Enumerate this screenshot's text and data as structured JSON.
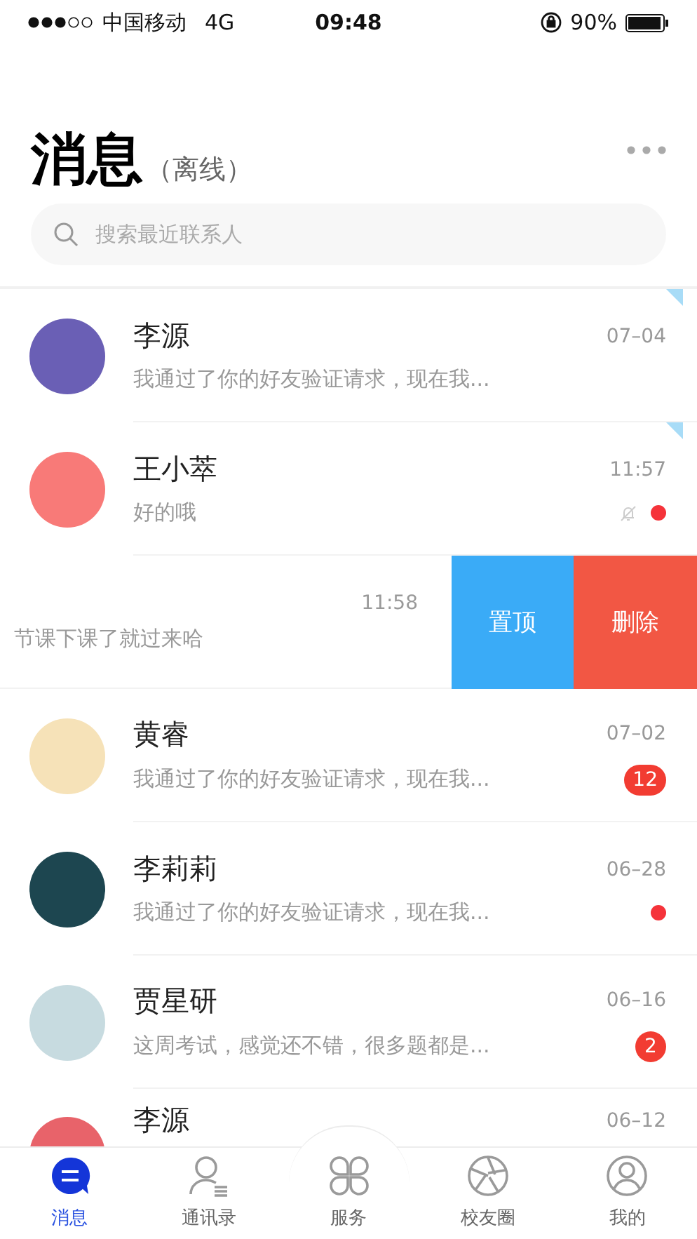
{
  "status_bar": {
    "carrier": "中国移动",
    "network": "4G",
    "time": "09:48",
    "battery": "90%"
  },
  "header": {
    "title": "消息",
    "subtitle": "（离线）"
  },
  "search": {
    "placeholder": "搜索最近联系人"
  },
  "conversations": [
    {
      "kind": "normal",
      "name": "李源",
      "preview": "我通过了你的好友验证请求，现在我...",
      "time": "07–04",
      "color": "#6a5fb5",
      "pinned": true,
      "muted": false,
      "dot": false
    },
    {
      "kind": "normal",
      "name": "王小萃",
      "preview": "好的哦",
      "time": "11:57",
      "color": "#f87a78",
      "pinned": true,
      "muted": true,
      "dot": true
    },
    {
      "kind": "swiped",
      "preview": "节课下课了就过来哈",
      "time": "11:58",
      "actions": [
        {
          "label": "置顶",
          "kind": "pin"
        },
        {
          "label": "删除",
          "kind": "delete"
        }
      ]
    },
    {
      "kind": "normal",
      "name": "黄睿",
      "preview": "我通过了你的好友验证请求，现在我...",
      "time": "07–02",
      "color": "#f6e2b8",
      "pinned": false,
      "muted": false,
      "dot": false,
      "badge": "12"
    },
    {
      "kind": "normal",
      "name": "李莉莉",
      "preview": "我通过了你的好友验证请求，现在我...",
      "time": "06–28",
      "color": "#1d4650",
      "pinned": false,
      "muted": false,
      "dot": true
    },
    {
      "kind": "normal",
      "name": "贾星研",
      "preview": "这周考试，感觉还不错，很多题都是...",
      "time": "06–16",
      "color": "#c7dbe0",
      "pinned": false,
      "muted": false,
      "dot": false,
      "badge": "2"
    },
    {
      "kind": "partial",
      "name": "李源",
      "time": "06–12",
      "color": "#e8636a"
    }
  ],
  "tab_bar": [
    {
      "label": "消息",
      "selected": true
    },
    {
      "label": "通讯录",
      "selected": false
    },
    {
      "label": "服务",
      "selected": false
    },
    {
      "label": "校友圈",
      "selected": false
    },
    {
      "label": "我的",
      "selected": false
    }
  ]
}
